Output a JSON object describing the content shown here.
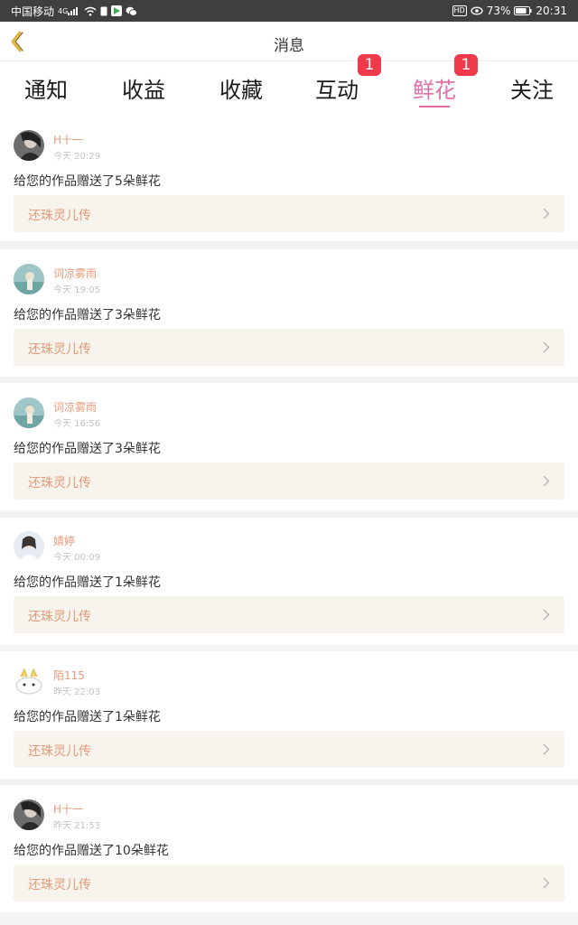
{
  "status_bar": {
    "carrier": "中国移动",
    "signal": "4G",
    "hd": "HD",
    "battery": "73%",
    "time": "20:31",
    "icons": [
      "signal-icon",
      "wifi-icon",
      "sim-icon",
      "play-store-icon",
      "wechat-icon",
      "eye-icon",
      "battery-icon"
    ]
  },
  "header": {
    "title": "消息",
    "back_icon": "chevron-left-icon"
  },
  "tabs": [
    {
      "label": "通知",
      "badge": ""
    },
    {
      "label": "收益",
      "badge": ""
    },
    {
      "label": "收藏",
      "badge": ""
    },
    {
      "label": "互动",
      "badge": "1"
    },
    {
      "label": "鲜花",
      "badge": "1",
      "active": true
    },
    {
      "label": "关注",
      "badge": ""
    }
  ],
  "colors": {
    "accent": "#e06ea8",
    "badge": "#f0394b",
    "username": "#e39a78",
    "work_box_bg": "#f6f4ec"
  },
  "messages": [
    {
      "user": "H十一",
      "time": "今天 20:29",
      "text": "给您的作品赠送了5朵鲜花",
      "work": "还珠灵儿传",
      "avatar": "avatar-dark"
    },
    {
      "user": "词凉雾雨",
      "time": "今天 19:05",
      "text": "给您的作品赠送了3朵鲜花",
      "work": "还珠灵儿传",
      "avatar": "avatar-sea"
    },
    {
      "user": "词凉雾雨",
      "time": "今天 16:56",
      "text": "给您的作品赠送了3朵鲜花",
      "work": "还珠灵儿传",
      "avatar": "avatar-sea"
    },
    {
      "user": "婧婷",
      "time": "今天 00:09",
      "text": "给您的作品赠送了1朵鲜花",
      "work": "还珠灵儿传",
      "avatar": "avatar-girl"
    },
    {
      "user": "陌115",
      "time": "昨天 22:03",
      "text": "给您的作品赠送了1朵鲜花",
      "work": "还珠灵儿传",
      "avatar": "avatar-cat"
    },
    {
      "user": "H十一",
      "time": "昨天 21:53",
      "text": "给您的作品赠送了10朵鲜花",
      "work": "还珠灵儿传",
      "avatar": "avatar-dark"
    }
  ]
}
